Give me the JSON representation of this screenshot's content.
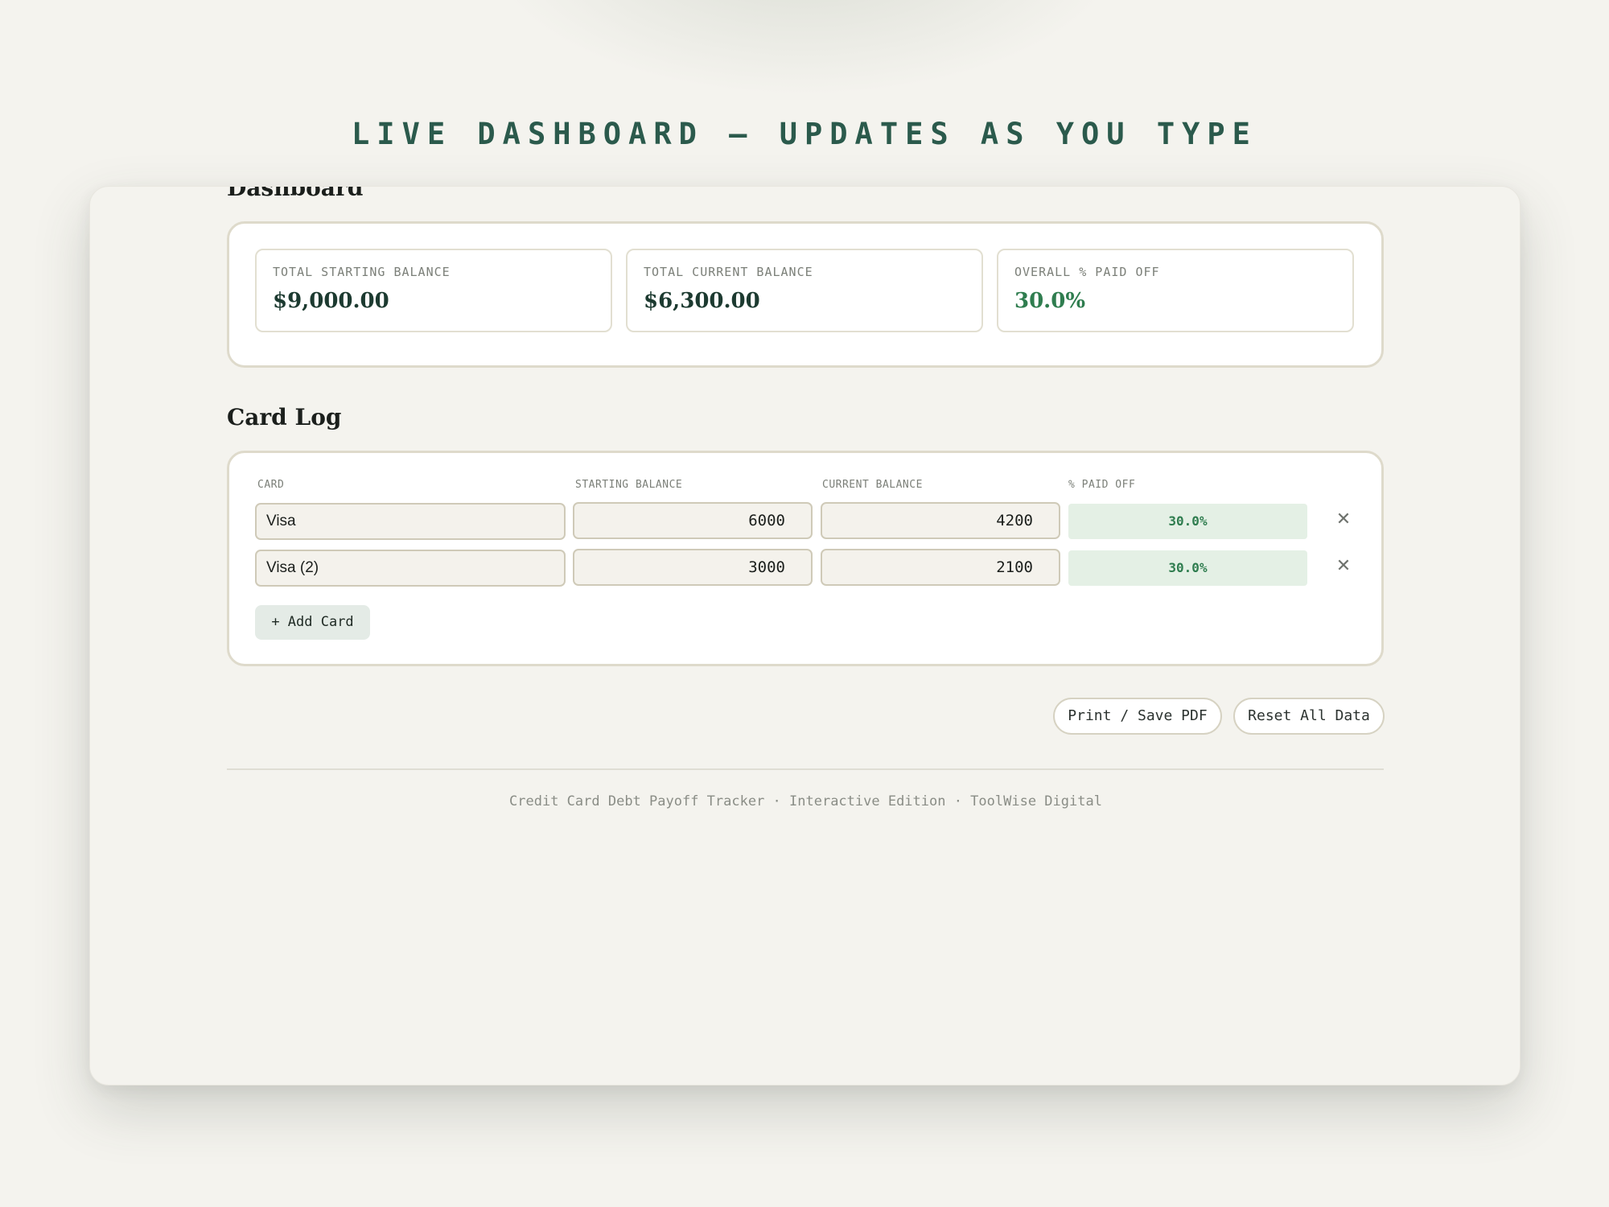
{
  "headline": "LIVE DASHBOARD — UPDATES AS YOU TYPE",
  "dashboard": {
    "title": "Dashboard",
    "stats": [
      {
        "label": "TOTAL STARTING BALANCE",
        "value": "$9,000.00"
      },
      {
        "label": "TOTAL CURRENT BALANCE",
        "value": "$6,300.00"
      },
      {
        "label": "OVERALL % PAID OFF",
        "value": "30.0%"
      }
    ]
  },
  "card_log": {
    "title": "Card Log",
    "columns": [
      "CARD",
      "STARTING BALANCE",
      "CURRENT BALANCE",
      "% PAID OFF"
    ],
    "rows": [
      {
        "card": "Visa",
        "starting": "6000",
        "current": "4200",
        "paid": "30.0%"
      },
      {
        "card": "Visa (2)",
        "starting": "3000",
        "current": "2100",
        "paid": "30.0%"
      }
    ],
    "delete_glyph": "✕",
    "add_label": "+ Add Card"
  },
  "actions": {
    "print_label": "Print / Save PDF",
    "reset_label": "Reset All Data"
  },
  "footer": "Credit Card Debt Payoff Tracker · Interactive Edition · ToolWise Digital",
  "colors": {
    "accent": "#2b5a4c",
    "paid_green": "#2f7d4f",
    "paid_bg": "#e4f0e5",
    "background": "#f4f3ee"
  }
}
